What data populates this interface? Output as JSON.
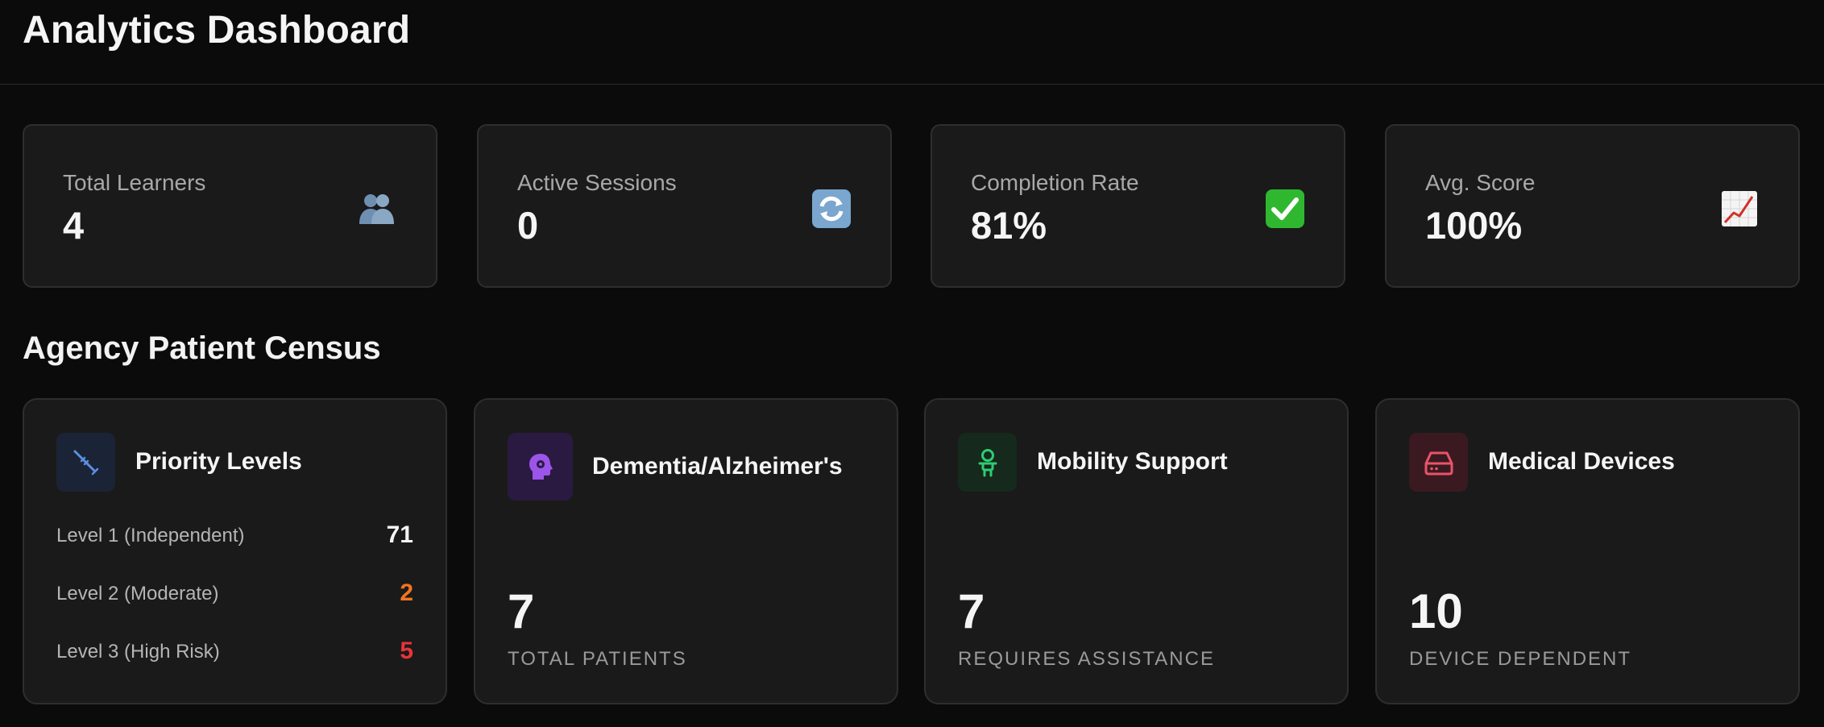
{
  "header": {
    "title": "Analytics Dashboard"
  },
  "stats": [
    {
      "label": "Total Learners",
      "value": "4",
      "icon": "people-icon"
    },
    {
      "label": "Active Sessions",
      "value": "0",
      "icon": "refresh-icon"
    },
    {
      "label": "Completion Rate",
      "value": "81%",
      "icon": "check-icon"
    },
    {
      "label": "Avg. Score",
      "value": "100%",
      "icon": "chart-up-icon"
    }
  ],
  "census": {
    "title": "Agency Patient Census",
    "priority": {
      "title": "Priority Levels",
      "icon": "syringe-icon",
      "accent": "#5b8fe0",
      "levels": [
        {
          "label": "Level 1 (Independent)",
          "value": "71",
          "color": "#f5f5f5"
        },
        {
          "label": "Level 2 (Moderate)",
          "value": "2",
          "color": "#f2741f"
        },
        {
          "label": "Level 3 (High Risk)",
          "value": "5",
          "color": "#e8333a"
        }
      ]
    },
    "dementia": {
      "title": "Dementia/Alzheimer's",
      "icon": "brain-head-icon",
      "accent": "#9b55e8",
      "count": "7",
      "caption": "TOTAL PATIENTS"
    },
    "mobility": {
      "title": "Mobility Support",
      "icon": "accessibility-icon",
      "accent": "#2ecc71",
      "count": "7",
      "caption": "REQUIRES ASSISTANCE"
    },
    "devices": {
      "title": "Medical Devices",
      "icon": "hard-drive-icon",
      "accent": "#e8546a",
      "count": "10",
      "caption": "DEVICE DEPENDENT"
    }
  }
}
